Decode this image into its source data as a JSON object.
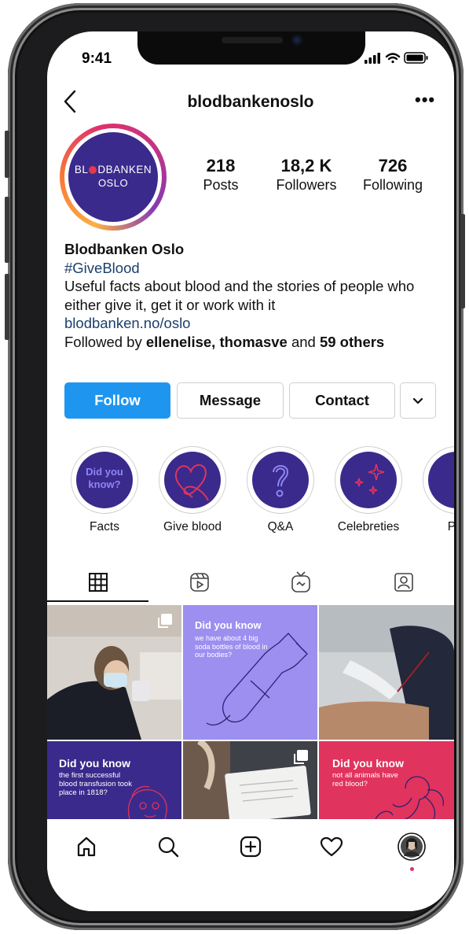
{
  "status_bar": {
    "time": "9:41"
  },
  "header": {
    "username": "blodbankenoslo",
    "back_icon": "chevron-left-icon",
    "more_label": "•••"
  },
  "profile": {
    "avatar_line1_left": "BL",
    "avatar_line1_right": "DBANKEN",
    "avatar_line2": "OSLO",
    "stats": [
      {
        "value": "218",
        "label": "Posts"
      },
      {
        "value": "18,2 K",
        "label": "Followers"
      },
      {
        "value": "726",
        "label": "Following"
      }
    ]
  },
  "bio": {
    "name": "Blodbanken Oslo",
    "hashtag": "#GiveBlood",
    "description": "Useful facts about blood and the stories of people who either give it, get it or work with it",
    "link": "blodbanken.no/oslo",
    "followed_prefix": "Followed by ",
    "followed_users": "ellenelise, thomasve",
    "followed_mid": " and ",
    "followed_count": "59 others"
  },
  "actions": {
    "follow": "Follow",
    "message": "Message",
    "contact": "Contact",
    "more": "⌄"
  },
  "highlights": [
    {
      "label": "Facts",
      "cover_text": "Did you know?"
    },
    {
      "label": "Give blood"
    },
    {
      "label": "Q&A"
    },
    {
      "label": "Celebreties"
    },
    {
      "label": "Pla"
    }
  ],
  "tabs": [
    "grid-icon",
    "reels-icon",
    "igtv-icon",
    "tagged-icon"
  ],
  "posts": {
    "p2": {
      "title": "Did you know",
      "body": "we have about 4 big soda bottles of blood in our bodies?"
    },
    "p4": {
      "title": "Did you know",
      "body": "the first successful blood transfusion took place in 1818?"
    },
    "p6": {
      "title": "Did you know",
      "body": "not all animals have red blood?"
    }
  },
  "bottom_nav": [
    "home-icon",
    "search-icon",
    "new-post-icon",
    "activity-heart-icon",
    "profile-avatar"
  ],
  "colors": {
    "brand_purple": "#3a2a8c",
    "follow_blue": "#1e96f0",
    "post_lavender": "#9c8ff0",
    "post_pink": "#e0335d",
    "blood_red": "#e23a4e"
  }
}
